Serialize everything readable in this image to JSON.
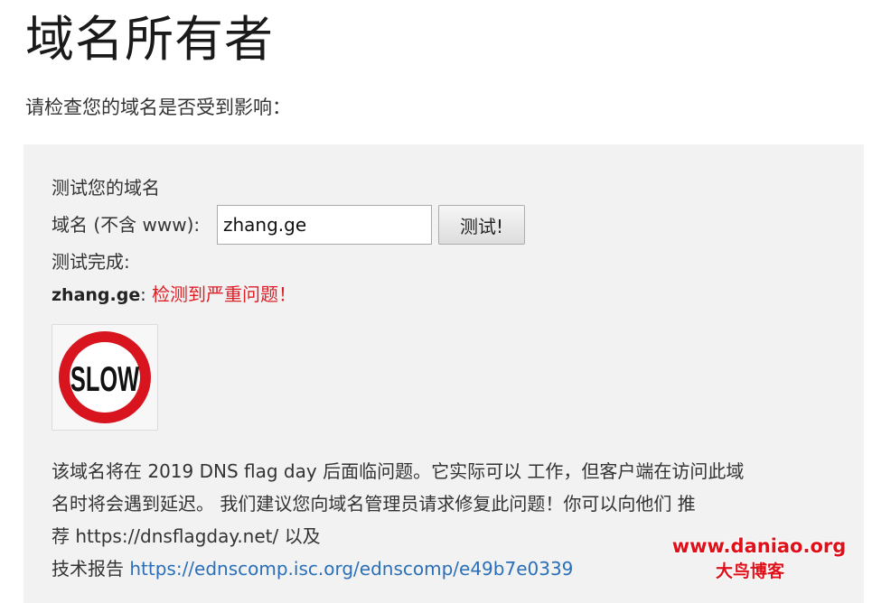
{
  "header": {
    "title": "域名所有者",
    "intro": "请检查您的域名是否受到影响："
  },
  "test_panel": {
    "heading": "测试您的域名",
    "input_label": "域名 (不含 www):",
    "input_value": "zhang.ge",
    "button_label": "测试!",
    "status_text": "测试完成:",
    "result": {
      "domain": "zhang.ge",
      "separator": ":",
      "message": "检测到严重问题！",
      "message_color": "#dd1f26"
    },
    "slow_sign": {
      "text": "SLOW",
      "ring_color": "#d8141f"
    },
    "description": {
      "line1": "该域名将在 2019 DNS flag day 后面临问题。它实际可以 工作，但客户端在访问此域",
      "line2": "名时将会遇到延迟。 我们建议您向域名管理员请求修复此问题！你可以向他们 推",
      "line3": "荐 https://dnsflagday.net/ 以及",
      "report_prefix": "技术报告",
      "report_link": "https://ednscomp.isc.org/ednscomp/e49b7e0339",
      "link_color": "#2a6fb7"
    }
  },
  "watermark": {
    "url": "www.daniao.org",
    "name": "大鸟博客",
    "color": "#e0101a"
  }
}
